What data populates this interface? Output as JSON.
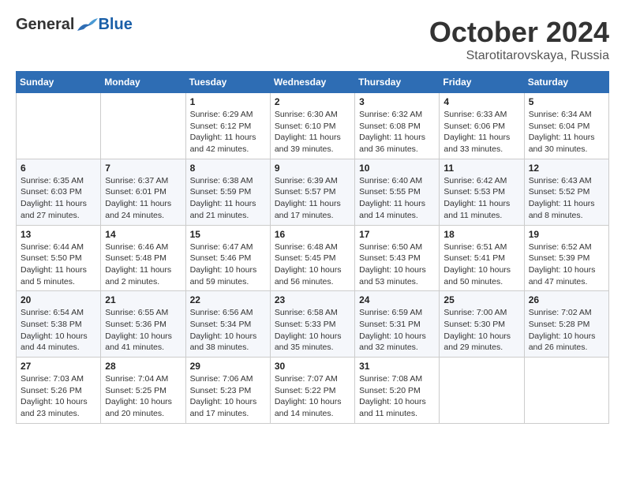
{
  "header": {
    "logo": {
      "general": "General",
      "blue": "Blue"
    },
    "title": "October 2024",
    "location": "Starotitarovskaya, Russia"
  },
  "calendar": {
    "days_of_week": [
      "Sunday",
      "Monday",
      "Tuesday",
      "Wednesday",
      "Thursday",
      "Friday",
      "Saturday"
    ],
    "weeks": [
      [
        {
          "day": "",
          "info": ""
        },
        {
          "day": "",
          "info": ""
        },
        {
          "day": "1",
          "info": "Sunrise: 6:29 AM\nSunset: 6:12 PM\nDaylight: 11 hours and 42 minutes."
        },
        {
          "day": "2",
          "info": "Sunrise: 6:30 AM\nSunset: 6:10 PM\nDaylight: 11 hours and 39 minutes."
        },
        {
          "day": "3",
          "info": "Sunrise: 6:32 AM\nSunset: 6:08 PM\nDaylight: 11 hours and 36 minutes."
        },
        {
          "day": "4",
          "info": "Sunrise: 6:33 AM\nSunset: 6:06 PM\nDaylight: 11 hours and 33 minutes."
        },
        {
          "day": "5",
          "info": "Sunrise: 6:34 AM\nSunset: 6:04 PM\nDaylight: 11 hours and 30 minutes."
        }
      ],
      [
        {
          "day": "6",
          "info": "Sunrise: 6:35 AM\nSunset: 6:03 PM\nDaylight: 11 hours and 27 minutes."
        },
        {
          "day": "7",
          "info": "Sunrise: 6:37 AM\nSunset: 6:01 PM\nDaylight: 11 hours and 24 minutes."
        },
        {
          "day": "8",
          "info": "Sunrise: 6:38 AM\nSunset: 5:59 PM\nDaylight: 11 hours and 21 minutes."
        },
        {
          "day": "9",
          "info": "Sunrise: 6:39 AM\nSunset: 5:57 PM\nDaylight: 11 hours and 17 minutes."
        },
        {
          "day": "10",
          "info": "Sunrise: 6:40 AM\nSunset: 5:55 PM\nDaylight: 11 hours and 14 minutes."
        },
        {
          "day": "11",
          "info": "Sunrise: 6:42 AM\nSunset: 5:53 PM\nDaylight: 11 hours and 11 minutes."
        },
        {
          "day": "12",
          "info": "Sunrise: 6:43 AM\nSunset: 5:52 PM\nDaylight: 11 hours and 8 minutes."
        }
      ],
      [
        {
          "day": "13",
          "info": "Sunrise: 6:44 AM\nSunset: 5:50 PM\nDaylight: 11 hours and 5 minutes."
        },
        {
          "day": "14",
          "info": "Sunrise: 6:46 AM\nSunset: 5:48 PM\nDaylight: 11 hours and 2 minutes."
        },
        {
          "day": "15",
          "info": "Sunrise: 6:47 AM\nSunset: 5:46 PM\nDaylight: 10 hours and 59 minutes."
        },
        {
          "day": "16",
          "info": "Sunrise: 6:48 AM\nSunset: 5:45 PM\nDaylight: 10 hours and 56 minutes."
        },
        {
          "day": "17",
          "info": "Sunrise: 6:50 AM\nSunset: 5:43 PM\nDaylight: 10 hours and 53 minutes."
        },
        {
          "day": "18",
          "info": "Sunrise: 6:51 AM\nSunset: 5:41 PM\nDaylight: 10 hours and 50 minutes."
        },
        {
          "day": "19",
          "info": "Sunrise: 6:52 AM\nSunset: 5:39 PM\nDaylight: 10 hours and 47 minutes."
        }
      ],
      [
        {
          "day": "20",
          "info": "Sunrise: 6:54 AM\nSunset: 5:38 PM\nDaylight: 10 hours and 44 minutes."
        },
        {
          "day": "21",
          "info": "Sunrise: 6:55 AM\nSunset: 5:36 PM\nDaylight: 10 hours and 41 minutes."
        },
        {
          "day": "22",
          "info": "Sunrise: 6:56 AM\nSunset: 5:34 PM\nDaylight: 10 hours and 38 minutes."
        },
        {
          "day": "23",
          "info": "Sunrise: 6:58 AM\nSunset: 5:33 PM\nDaylight: 10 hours and 35 minutes."
        },
        {
          "day": "24",
          "info": "Sunrise: 6:59 AM\nSunset: 5:31 PM\nDaylight: 10 hours and 32 minutes."
        },
        {
          "day": "25",
          "info": "Sunrise: 7:00 AM\nSunset: 5:30 PM\nDaylight: 10 hours and 29 minutes."
        },
        {
          "day": "26",
          "info": "Sunrise: 7:02 AM\nSunset: 5:28 PM\nDaylight: 10 hours and 26 minutes."
        }
      ],
      [
        {
          "day": "27",
          "info": "Sunrise: 7:03 AM\nSunset: 5:26 PM\nDaylight: 10 hours and 23 minutes."
        },
        {
          "day": "28",
          "info": "Sunrise: 7:04 AM\nSunset: 5:25 PM\nDaylight: 10 hours and 20 minutes."
        },
        {
          "day": "29",
          "info": "Sunrise: 7:06 AM\nSunset: 5:23 PM\nDaylight: 10 hours and 17 minutes."
        },
        {
          "day": "30",
          "info": "Sunrise: 7:07 AM\nSunset: 5:22 PM\nDaylight: 10 hours and 14 minutes."
        },
        {
          "day": "31",
          "info": "Sunrise: 7:08 AM\nSunset: 5:20 PM\nDaylight: 10 hours and 11 minutes."
        },
        {
          "day": "",
          "info": ""
        },
        {
          "day": "",
          "info": ""
        }
      ]
    ]
  }
}
